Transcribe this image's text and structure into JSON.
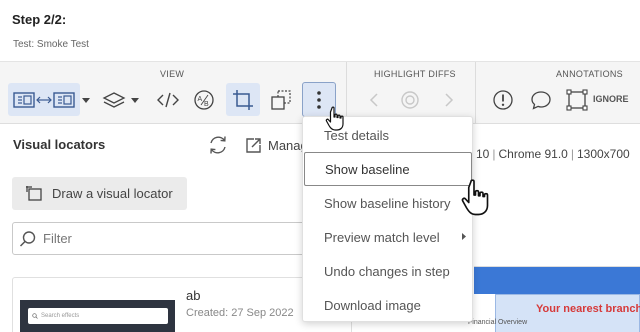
{
  "header": {
    "step_title": "Step 2/2:",
    "test_name": "Test: Smoke Test"
  },
  "toolbar": {
    "sections": {
      "view": "VIEW",
      "highlight_diffs": "HIGHLIGHT DIFFS",
      "annotations": "ANNOTATIONS"
    },
    "ignore_label": "IGNORE"
  },
  "panel": {
    "title": "Visual locators",
    "manage_label": "Manag",
    "draw_button": "Draw a visual locator",
    "filter_placeholder": "Filter",
    "locator": {
      "name": "ab",
      "created": "Created: 27 Sep 2022",
      "thumb_search": "Search effects"
    }
  },
  "env_info": {
    "version": "10",
    "browser": "Chrome 91.0",
    "viewport": "1300x700"
  },
  "preview": {
    "branch_text": "Your nearest branch",
    "financial_text": "Financial Overview"
  },
  "menu": {
    "items": [
      "Test details",
      "Show baseline",
      "Show baseline history",
      "Preview match level",
      "Undo changes in step",
      "Download image"
    ]
  },
  "colors": {
    "accent_selected": "#dde6f5",
    "preview_blue": "#3b78d6",
    "branch_red": "#d63a3a"
  },
  "icons": [
    "compare-layout-icon",
    "dropdown-caret-icon",
    "layers-icon",
    "code-icon",
    "ab-compare-icon",
    "crop-icon",
    "region-icon",
    "more-vertical-icon",
    "chevron-left-icon",
    "match-icon",
    "chevron-right-icon",
    "alert-icon",
    "comment-icon",
    "ignore-region-icon",
    "refresh-icon",
    "external-link-icon",
    "draw-region-icon",
    "search-icon",
    "chevron-right-small-icon",
    "hand-cursor-icon"
  ]
}
